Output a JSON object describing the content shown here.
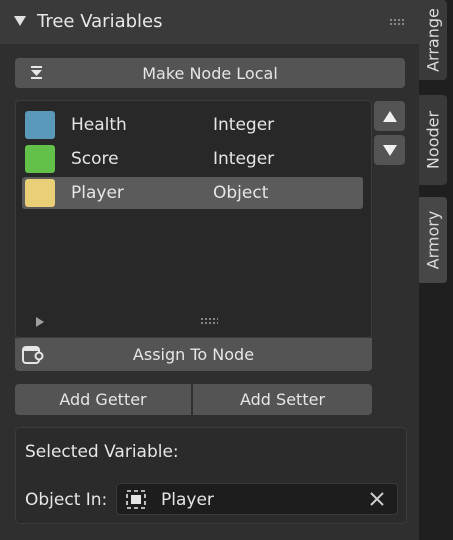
{
  "panel": {
    "title": "Tree Variables",
    "make_local_label": "Make Node Local",
    "assign_label": "Assign To Node",
    "add_getter_label": "Add Getter",
    "add_setter_label": "Add Setter"
  },
  "variables": [
    {
      "name": "Health",
      "type": "Integer",
      "color": "#5a99ba",
      "selected": false
    },
    {
      "name": "Score",
      "type": "Integer",
      "color": "#63c14a",
      "selected": false
    },
    {
      "name": "Player",
      "type": "Object",
      "color": "#e9cf78",
      "selected": true
    }
  ],
  "selected_section": {
    "heading": "Selected Variable:",
    "object_label": "Object In:",
    "object_value": "Player"
  },
  "side_tabs": [
    {
      "label": "Arrange"
    },
    {
      "label": "Nooder"
    },
    {
      "label": "Armory"
    }
  ],
  "icons": {
    "collapse": "triangle-down-icon",
    "make_local": "download-icon",
    "move_up": "arrow-up-icon",
    "move_down": "arrow-down-icon",
    "assign": "node-icon",
    "object": "object-cube-icon",
    "clear": "close-icon"
  }
}
